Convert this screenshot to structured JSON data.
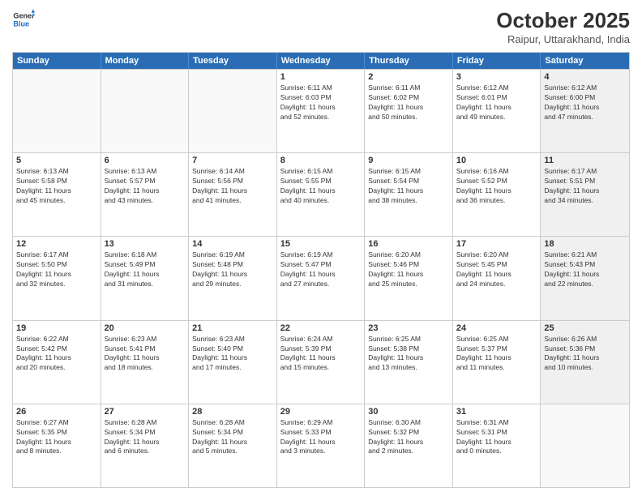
{
  "logo": {
    "line1": "General",
    "line2": "Blue"
  },
  "title": "October 2025",
  "location": "Raipur, Uttarakhand, India",
  "weekdays": [
    "Sunday",
    "Monday",
    "Tuesday",
    "Wednesday",
    "Thursday",
    "Friday",
    "Saturday"
  ],
  "weeks": [
    [
      {
        "day": "",
        "info": ""
      },
      {
        "day": "",
        "info": ""
      },
      {
        "day": "",
        "info": ""
      },
      {
        "day": "1",
        "info": "Sunrise: 6:11 AM\nSunset: 6:03 PM\nDaylight: 11 hours\nand 52 minutes."
      },
      {
        "day": "2",
        "info": "Sunrise: 6:11 AM\nSunset: 6:02 PM\nDaylight: 11 hours\nand 50 minutes."
      },
      {
        "day": "3",
        "info": "Sunrise: 6:12 AM\nSunset: 6:01 PM\nDaylight: 11 hours\nand 49 minutes."
      },
      {
        "day": "4",
        "info": "Sunrise: 6:12 AM\nSunset: 6:00 PM\nDaylight: 11 hours\nand 47 minutes."
      }
    ],
    [
      {
        "day": "5",
        "info": "Sunrise: 6:13 AM\nSunset: 5:58 PM\nDaylight: 11 hours\nand 45 minutes."
      },
      {
        "day": "6",
        "info": "Sunrise: 6:13 AM\nSunset: 5:57 PM\nDaylight: 11 hours\nand 43 minutes."
      },
      {
        "day": "7",
        "info": "Sunrise: 6:14 AM\nSunset: 5:56 PM\nDaylight: 11 hours\nand 41 minutes."
      },
      {
        "day": "8",
        "info": "Sunrise: 6:15 AM\nSunset: 5:55 PM\nDaylight: 11 hours\nand 40 minutes."
      },
      {
        "day": "9",
        "info": "Sunrise: 6:15 AM\nSunset: 5:54 PM\nDaylight: 11 hours\nand 38 minutes."
      },
      {
        "day": "10",
        "info": "Sunrise: 6:16 AM\nSunset: 5:52 PM\nDaylight: 11 hours\nand 36 minutes."
      },
      {
        "day": "11",
        "info": "Sunrise: 6:17 AM\nSunset: 5:51 PM\nDaylight: 11 hours\nand 34 minutes."
      }
    ],
    [
      {
        "day": "12",
        "info": "Sunrise: 6:17 AM\nSunset: 5:50 PM\nDaylight: 11 hours\nand 32 minutes."
      },
      {
        "day": "13",
        "info": "Sunrise: 6:18 AM\nSunset: 5:49 PM\nDaylight: 11 hours\nand 31 minutes."
      },
      {
        "day": "14",
        "info": "Sunrise: 6:19 AM\nSunset: 5:48 PM\nDaylight: 11 hours\nand 29 minutes."
      },
      {
        "day": "15",
        "info": "Sunrise: 6:19 AM\nSunset: 5:47 PM\nDaylight: 11 hours\nand 27 minutes."
      },
      {
        "day": "16",
        "info": "Sunrise: 6:20 AM\nSunset: 5:46 PM\nDaylight: 11 hours\nand 25 minutes."
      },
      {
        "day": "17",
        "info": "Sunrise: 6:20 AM\nSunset: 5:45 PM\nDaylight: 11 hours\nand 24 minutes."
      },
      {
        "day": "18",
        "info": "Sunrise: 6:21 AM\nSunset: 5:43 PM\nDaylight: 11 hours\nand 22 minutes."
      }
    ],
    [
      {
        "day": "19",
        "info": "Sunrise: 6:22 AM\nSunset: 5:42 PM\nDaylight: 11 hours\nand 20 minutes."
      },
      {
        "day": "20",
        "info": "Sunrise: 6:23 AM\nSunset: 5:41 PM\nDaylight: 11 hours\nand 18 minutes."
      },
      {
        "day": "21",
        "info": "Sunrise: 6:23 AM\nSunset: 5:40 PM\nDaylight: 11 hours\nand 17 minutes."
      },
      {
        "day": "22",
        "info": "Sunrise: 6:24 AM\nSunset: 5:39 PM\nDaylight: 11 hours\nand 15 minutes."
      },
      {
        "day": "23",
        "info": "Sunrise: 6:25 AM\nSunset: 5:38 PM\nDaylight: 11 hours\nand 13 minutes."
      },
      {
        "day": "24",
        "info": "Sunrise: 6:25 AM\nSunset: 5:37 PM\nDaylight: 11 hours\nand 11 minutes."
      },
      {
        "day": "25",
        "info": "Sunrise: 6:26 AM\nSunset: 5:36 PM\nDaylight: 11 hours\nand 10 minutes."
      }
    ],
    [
      {
        "day": "26",
        "info": "Sunrise: 6:27 AM\nSunset: 5:35 PM\nDaylight: 11 hours\nand 8 minutes."
      },
      {
        "day": "27",
        "info": "Sunrise: 6:28 AM\nSunset: 5:34 PM\nDaylight: 11 hours\nand 6 minutes."
      },
      {
        "day": "28",
        "info": "Sunrise: 6:28 AM\nSunset: 5:34 PM\nDaylight: 11 hours\nand 5 minutes."
      },
      {
        "day": "29",
        "info": "Sunrise: 6:29 AM\nSunset: 5:33 PM\nDaylight: 11 hours\nand 3 minutes."
      },
      {
        "day": "30",
        "info": "Sunrise: 6:30 AM\nSunset: 5:32 PM\nDaylight: 11 hours\nand 2 minutes."
      },
      {
        "day": "31",
        "info": "Sunrise: 6:31 AM\nSunset: 5:31 PM\nDaylight: 11 hours\nand 0 minutes."
      },
      {
        "day": "",
        "info": ""
      }
    ]
  ]
}
